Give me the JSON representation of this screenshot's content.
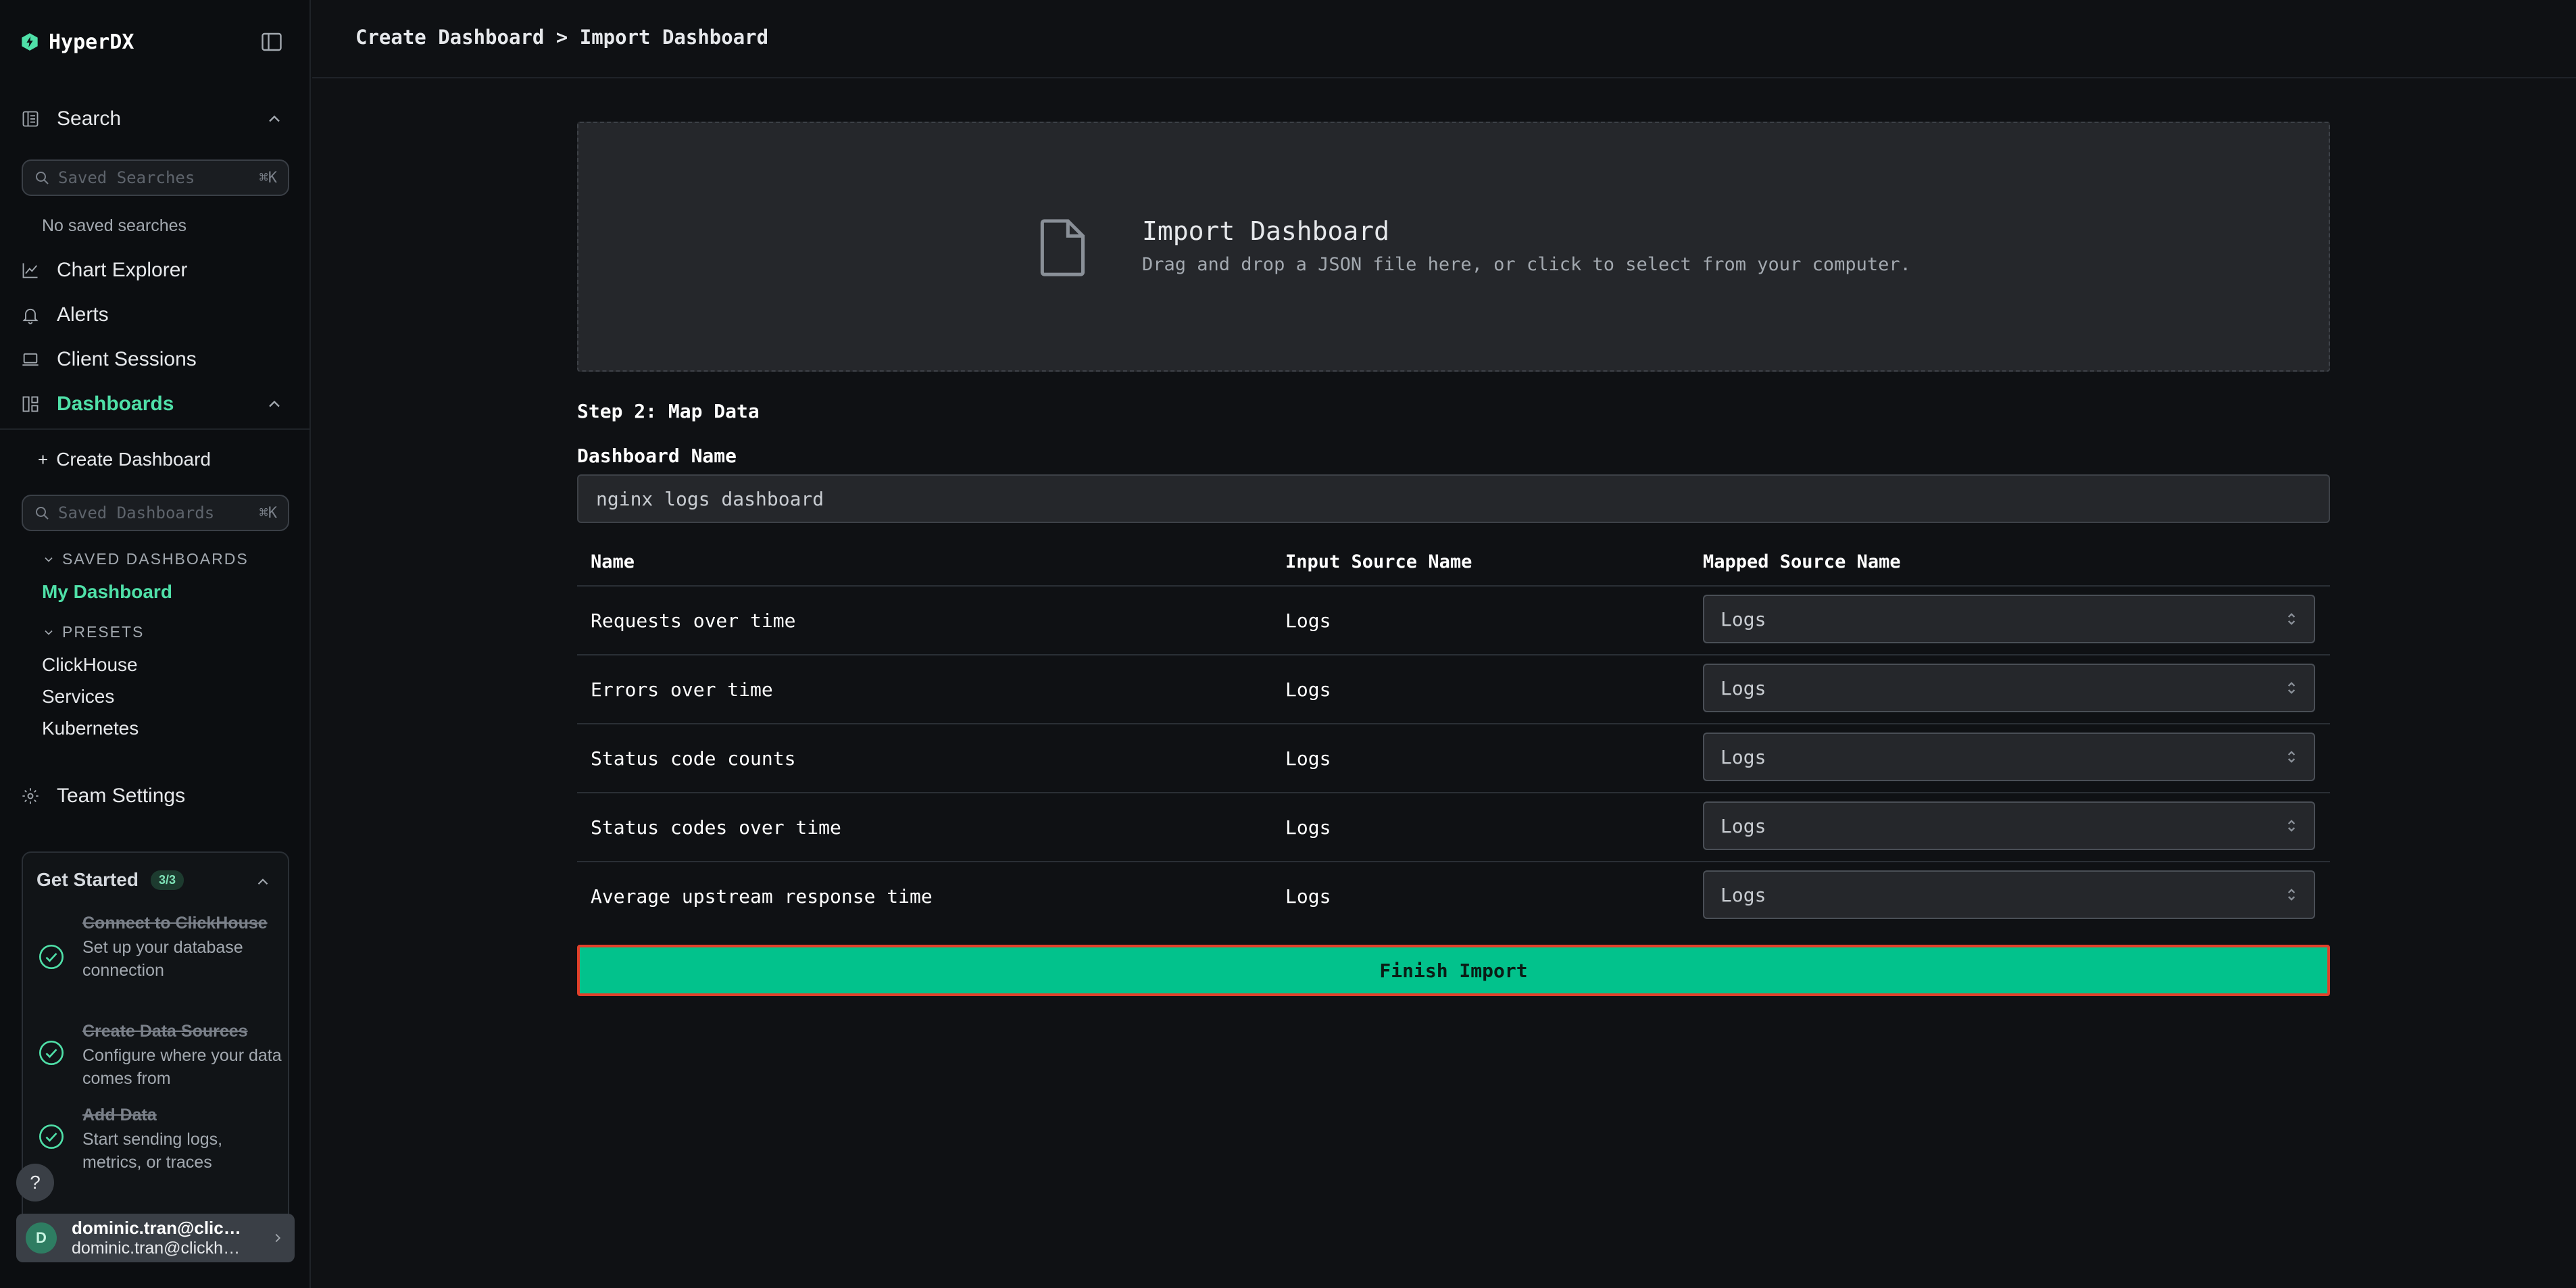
{
  "sidebar": {
    "brand": "HyperDX",
    "search_label": "Search",
    "saved_searches_placeholder": "Saved Searches",
    "saved_searches_shortcut": "⌘K",
    "no_saved_searches": "No saved searches",
    "chart_explorer": "Chart Explorer",
    "alerts": "Alerts",
    "client_sessions": "Client Sessions",
    "dashboards": "Dashboards",
    "create_dashboard": "Create Dashboard",
    "saved_dashboards_placeholder": "Saved Dashboards",
    "saved_dashboards_shortcut": "⌘K",
    "saved_dashboards_header": "SAVED DASHBOARDS",
    "my_dashboard": "My Dashboard",
    "presets_header": "PRESETS",
    "presets": [
      "ClickHouse",
      "Services",
      "Kubernetes"
    ],
    "team_settings": "Team Settings",
    "get_started": {
      "title": "Get Started",
      "badge": "3/3",
      "steps": [
        {
          "title": "Connect to ClickHouse",
          "desc": "Set up your database connection"
        },
        {
          "title": "Create Data Sources",
          "desc": "Configure where your data comes from"
        },
        {
          "title": "Add Data",
          "desc": "Start sending logs, metrics, or traces"
        }
      ]
    },
    "help": "?",
    "user": {
      "initial": "D",
      "name": "dominic.tran@clickhouse.com",
      "email": "dominic.tran@clickhouse.com"
    }
  },
  "header": {
    "breadcrumb": "Create Dashboard > Import Dashboard"
  },
  "dropzone": {
    "title": "Import Dashboard",
    "description": "Drag and drop a JSON file here, or click to select from your computer."
  },
  "form": {
    "step_label": "Step 2: Map Data",
    "dashboard_name_label": "Dashboard Name",
    "dashboard_name_value": "nginx logs dashboard",
    "columns": [
      "Name",
      "Input Source Name",
      "Mapped Source Name"
    ],
    "rows": [
      {
        "name": "Requests over time",
        "input": "Logs",
        "mapped": "Logs"
      },
      {
        "name": "Errors over time",
        "input": "Logs",
        "mapped": "Logs"
      },
      {
        "name": "Status code counts",
        "input": "Logs",
        "mapped": "Logs"
      },
      {
        "name": "Status codes over time",
        "input": "Logs",
        "mapped": "Logs"
      },
      {
        "name": "Average upstream response time",
        "input": "Logs",
        "mapped": "Logs"
      }
    ],
    "finish_button": "Finish Import"
  },
  "colors": {
    "accent": "#4fe0a8",
    "primary_button": "#02c28c",
    "button_outline": "#e0402a",
    "background": "#0f1114"
  }
}
